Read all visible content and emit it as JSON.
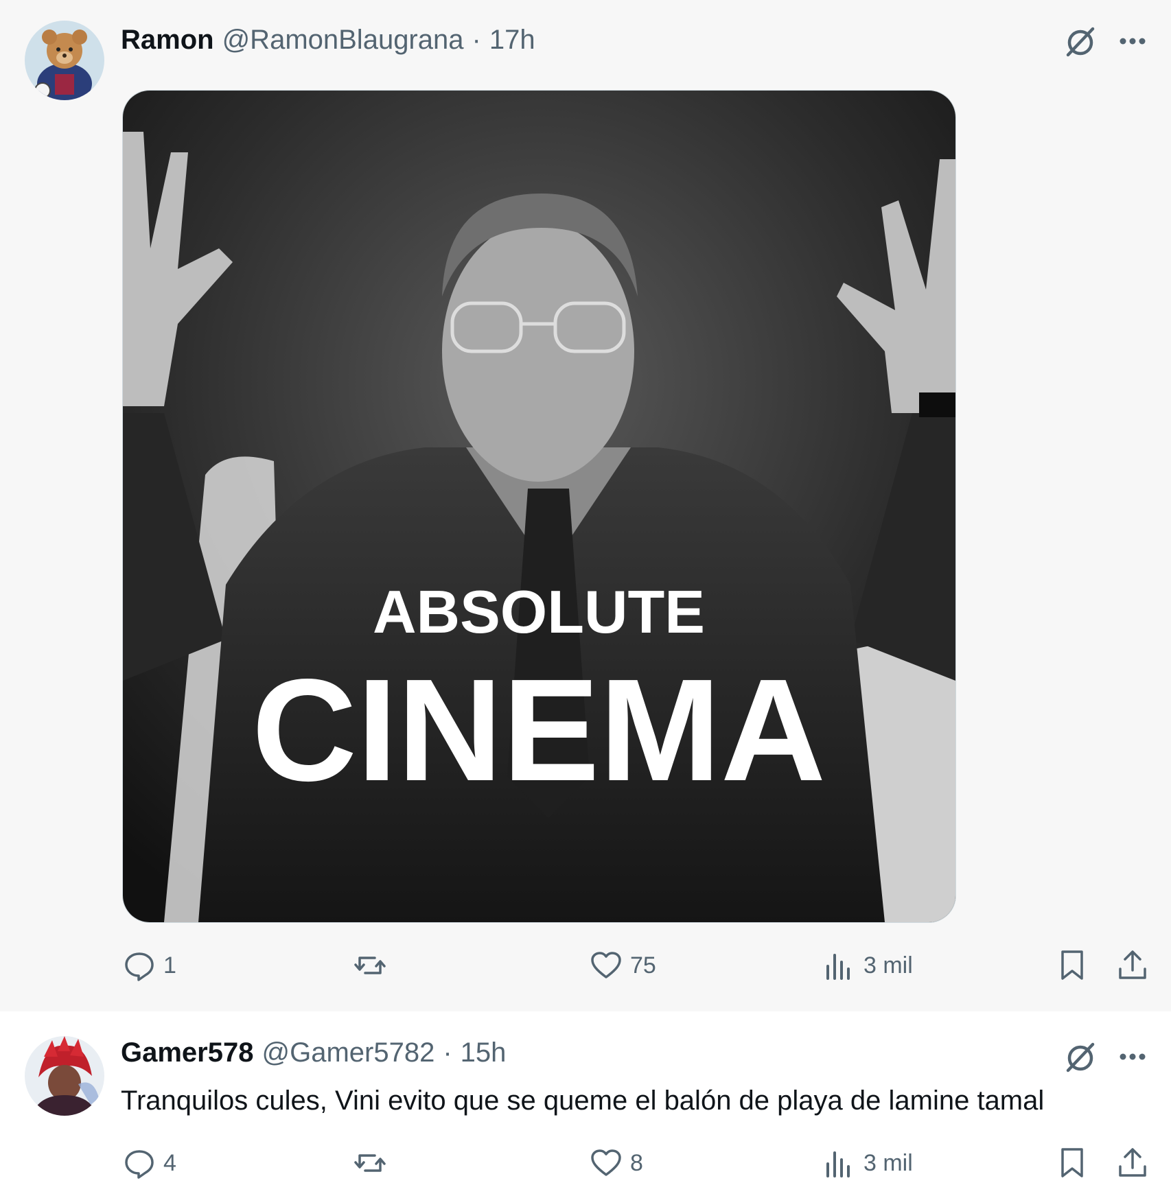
{
  "tweets": [
    {
      "author": {
        "name": "Ramon",
        "handle": "@RamonBlaugrana"
      },
      "separator": "·",
      "time": "17h",
      "media": {
        "line1": "ABSOLUTE",
        "line2": "CINEMA"
      },
      "stats": {
        "replies": "1",
        "reposts": "",
        "likes": "75",
        "views": "3 mil"
      },
      "icons": [
        "grok-icon",
        "more-icon",
        "reply-icon",
        "repost-icon",
        "like-icon",
        "views-icon",
        "bookmark-icon",
        "share-icon"
      ]
    },
    {
      "author": {
        "name": "Gamer578",
        "handle": "@Gamer5782"
      },
      "separator": "·",
      "time": "15h",
      "text": "Tranquilos cules, Vini evito que se queme el balón de playa de lamine tamal",
      "stats": {
        "replies": "4",
        "reposts": "",
        "likes": "8",
        "views": "3 mil"
      },
      "icons": [
        "grok-icon",
        "more-icon",
        "reply-icon",
        "repost-icon",
        "like-icon",
        "views-icon",
        "bookmark-icon",
        "share-icon"
      ]
    }
  ],
  "colors": {
    "text": "#0f1419",
    "secondary": "#536471",
    "background": "#ffffff",
    "highlight": "#f7f7f7"
  }
}
